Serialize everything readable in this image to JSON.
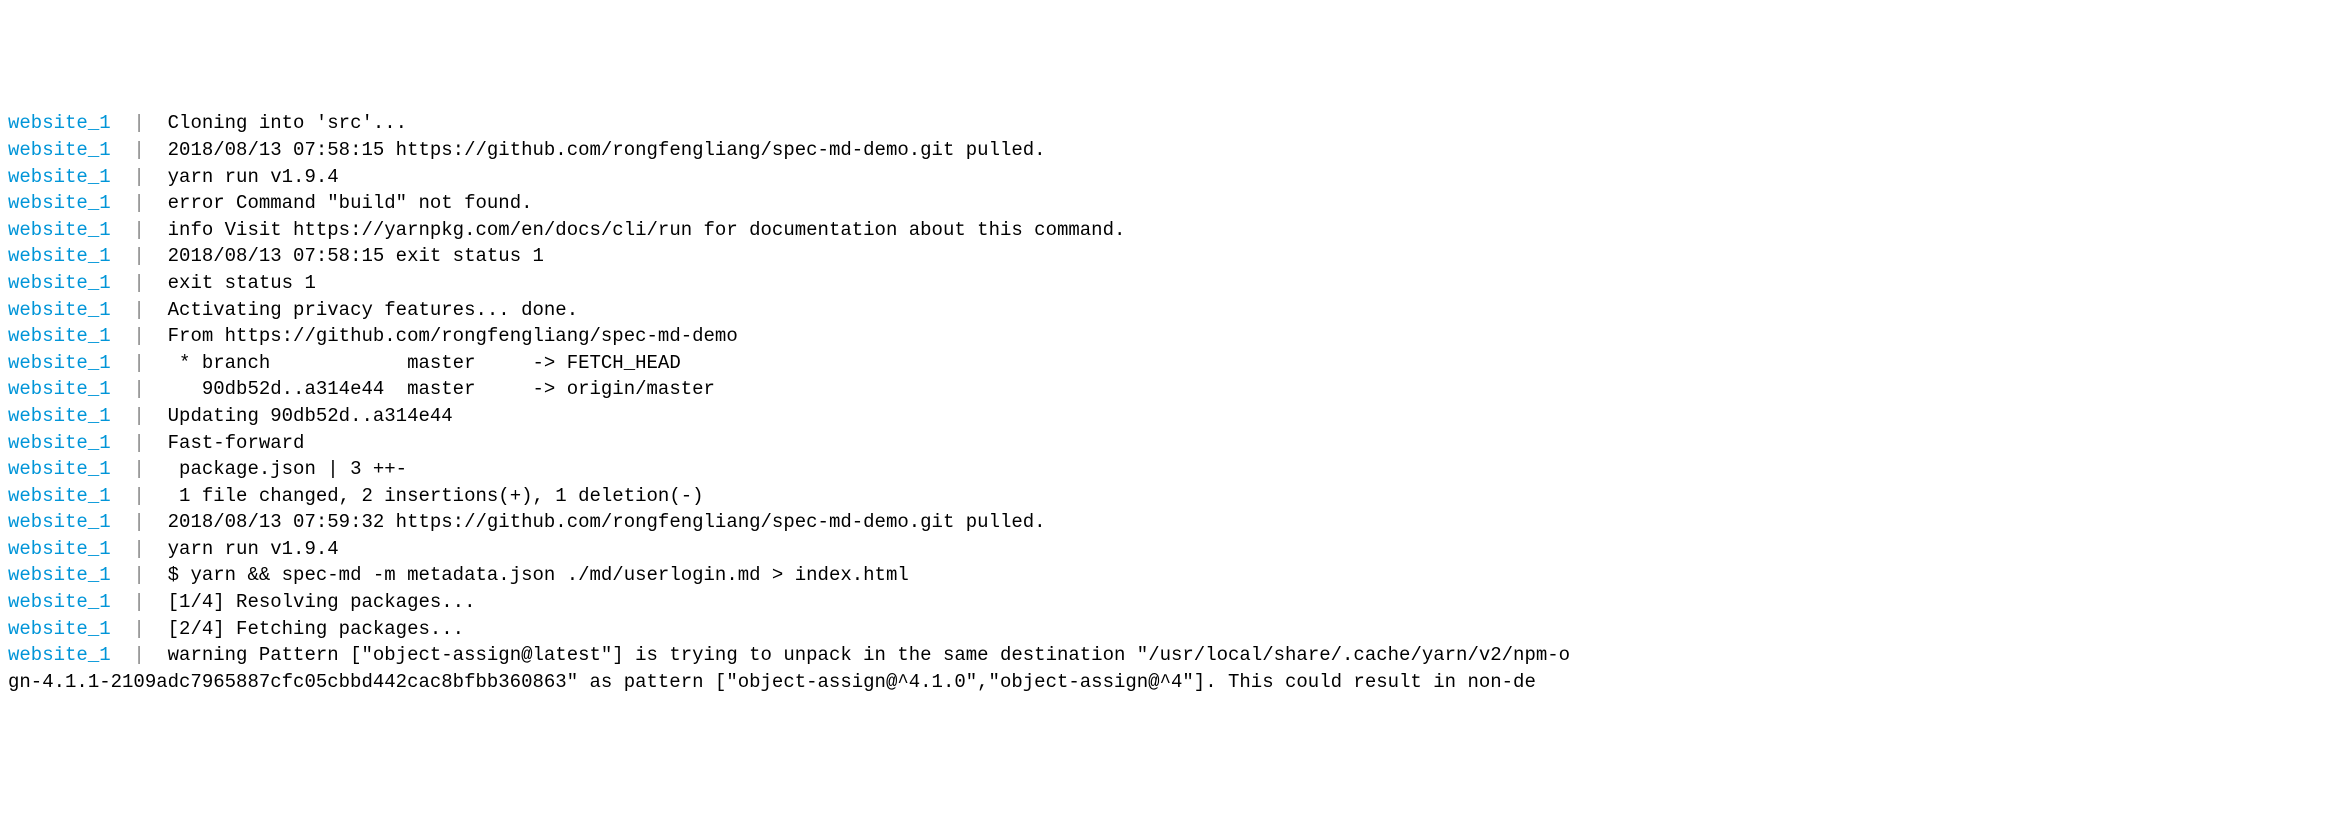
{
  "lines": [
    {
      "prefix": "website_1",
      "separator": "  | ",
      "content": " Cloning into 'src'..."
    },
    {
      "prefix": "website_1",
      "separator": "  | ",
      "content": " 2018/08/13 07:58:15 https://github.com/rongfengliang/spec-md-demo.git pulled."
    },
    {
      "prefix": "website_1",
      "separator": "  | ",
      "content": " yarn run v1.9.4"
    },
    {
      "prefix": "website_1",
      "separator": "  | ",
      "content": " error Command \"build\" not found."
    },
    {
      "prefix": "website_1",
      "separator": "  | ",
      "content": " info Visit https://yarnpkg.com/en/docs/cli/run for documentation about this command."
    },
    {
      "prefix": "website_1",
      "separator": "  | ",
      "content": " 2018/08/13 07:58:15 exit status 1"
    },
    {
      "prefix": "website_1",
      "separator": "  | ",
      "content": " exit status 1"
    },
    {
      "prefix": "website_1",
      "separator": "  | ",
      "content": " Activating privacy features... done."
    },
    {
      "prefix": "website_1",
      "separator": "  | ",
      "content": " From https://github.com/rongfengliang/spec-md-demo"
    },
    {
      "prefix": "website_1",
      "separator": "  | ",
      "content": "  * branch            master     -> FETCH_HEAD"
    },
    {
      "prefix": "website_1",
      "separator": "  | ",
      "content": "    90db52d..a314e44  master     -> origin/master"
    },
    {
      "prefix": "website_1",
      "separator": "  | ",
      "content": " Updating 90db52d..a314e44"
    },
    {
      "prefix": "website_1",
      "separator": "  | ",
      "content": " Fast-forward"
    },
    {
      "prefix": "website_1",
      "separator": "  | ",
      "content": "  package.json | 3 ++-"
    },
    {
      "prefix": "website_1",
      "separator": "  | ",
      "content": "  1 file changed, 2 insertions(+), 1 deletion(-)"
    },
    {
      "prefix": "website_1",
      "separator": "  | ",
      "content": " 2018/08/13 07:59:32 https://github.com/rongfengliang/spec-md-demo.git pulled."
    },
    {
      "prefix": "website_1",
      "separator": "  | ",
      "content": " yarn run v1.9.4"
    },
    {
      "prefix": "website_1",
      "separator": "  | ",
      "content": " $ yarn && spec-md -m metadata.json ./md/userlogin.md > index.html"
    },
    {
      "prefix": "website_1",
      "separator": "  | ",
      "content": " [1/4] Resolving packages..."
    },
    {
      "prefix": "website_1",
      "separator": "  | ",
      "content": " [2/4] Fetching packages..."
    },
    {
      "prefix": "website_1",
      "separator": "  | ",
      "content": " warning Pattern [\"object-assign@latest\"] is trying to unpack in the same destination \"/usr/local/share/.cache/yarn/v2/npm-o"
    }
  ],
  "continuation": "gn-4.1.1-2109adc7965887cfc05cbbd442cac8bfbb360863\" as pattern [\"object-assign@^4.1.0\",\"object-assign@^4\"]. This could result in non-de"
}
